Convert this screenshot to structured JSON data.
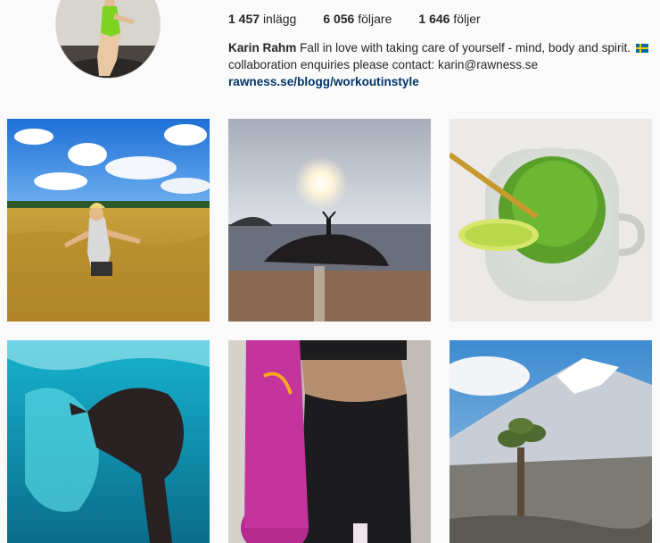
{
  "profile": {
    "stats": [
      {
        "count": "1 457",
        "label": "inlägg"
      },
      {
        "count": "6 056",
        "label": "följare"
      },
      {
        "count": "1 646",
        "label": "följer"
      }
    ],
    "full_name": "Karin Rahm",
    "bio_text": "Fall in love with taking care of yourself - mind, body and spirit. ",
    "bio_line2": "collaboration enquiries please contact: karin@rawness.se",
    "website": "rawness.se/blogg/workoutinstyle",
    "flag_colors": {
      "blue": "#006aa7",
      "yellow": "#fecc00"
    }
  },
  "grid": {
    "posts": [
      {
        "icon": "wheat-field-photo"
      },
      {
        "icon": "beach-sunset-photo"
      },
      {
        "icon": "green-smoothie-photo"
      },
      {
        "icon": "underwater-photo"
      },
      {
        "icon": "yoga-mat-photo"
      },
      {
        "icon": "mountain-landscape-photo"
      }
    ]
  }
}
